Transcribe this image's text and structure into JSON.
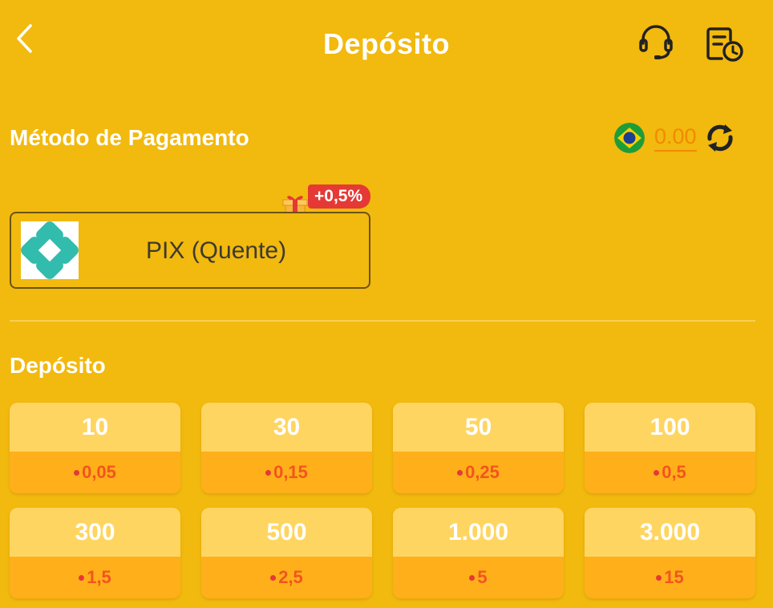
{
  "header": {
    "title": "Depósito",
    "back_icon": "chevron-left-icon",
    "support_icon": "headset-icon",
    "history_icon": "record-clock-icon"
  },
  "payment": {
    "section_title": "Método de Pagamento",
    "balance": "0.00",
    "currency_flag": "brazil-flag-icon",
    "refresh_icon": "refresh-icon",
    "methods": [
      {
        "label": "PIX (Quente)",
        "bonus": "+0,5%",
        "logo": "pix-logo-icon",
        "badge_icon": "gift-icon"
      }
    ]
  },
  "deposit": {
    "section_title": "Depósito",
    "amounts": [
      {
        "amount": "10",
        "bonus": "0,05"
      },
      {
        "amount": "30",
        "bonus": "0,15"
      },
      {
        "amount": "50",
        "bonus": "0,25"
      },
      {
        "amount": "100",
        "bonus": "0,5"
      },
      {
        "amount": "300",
        "bonus": "1,5"
      },
      {
        "amount": "500",
        "bonus": "2,5"
      },
      {
        "amount": "1.000",
        "bonus": "5"
      },
      {
        "amount": "3.000",
        "bonus": "15"
      }
    ]
  },
  "colors": {
    "background": "#F2B90E",
    "accent_orange": "#F08A00",
    "bonus_red": "#E53935",
    "card_top": "#FFD561",
    "card_bottom": "#FFAF1A",
    "pix_teal": "#32BCAD"
  }
}
